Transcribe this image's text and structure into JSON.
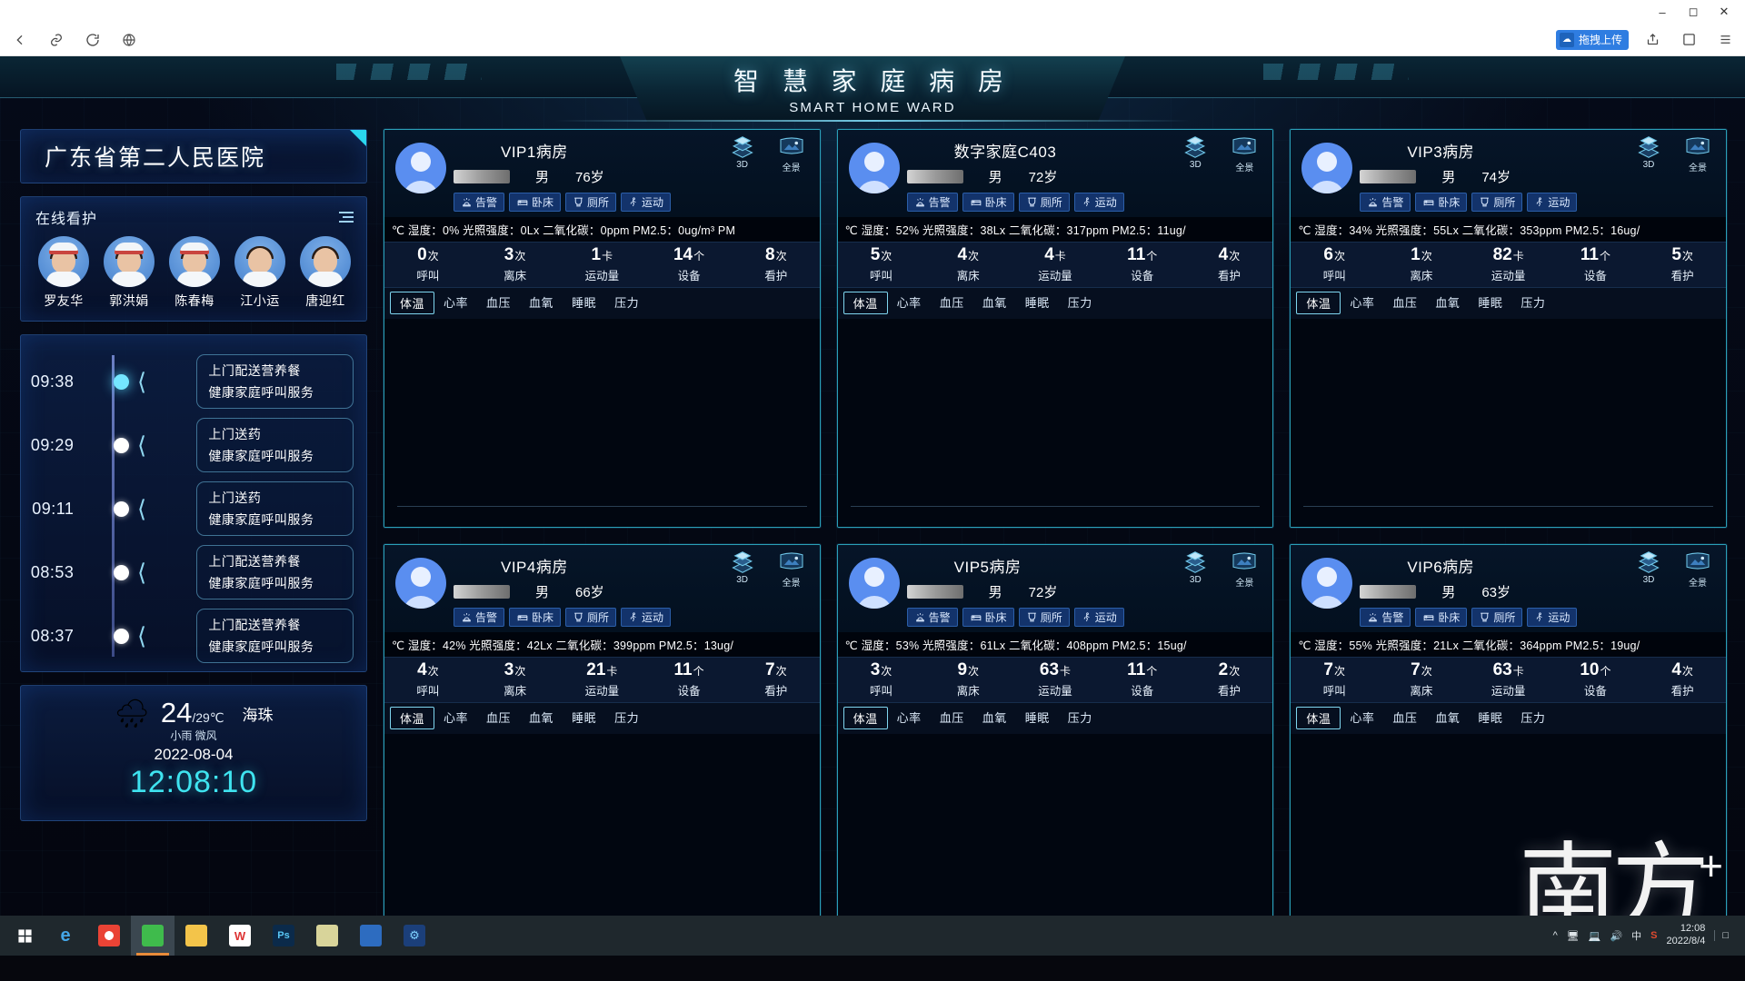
{
  "browser": {
    "window_buttons": [
      "minimize",
      "maximize",
      "close"
    ],
    "toolbar_icons": [
      "back-arrow",
      "link",
      "reload",
      "globe"
    ],
    "upload_chip_label": "拖拽上传",
    "right_icons": [
      "share",
      "box",
      "menu"
    ]
  },
  "header": {
    "title_cn": "智 慧 家 庭 病 房",
    "title_en": "SMART HOME WARD"
  },
  "sidebar": {
    "hospital": "广东省第二人民医院",
    "care": {
      "title": "在线看护",
      "nurses": [
        {
          "name": "罗友华"
        },
        {
          "name": "郭洪娟"
        },
        {
          "name": "陈春梅"
        },
        {
          "name": "江小运"
        },
        {
          "name": "唐迎红"
        }
      ]
    },
    "timeline": [
      {
        "time": "09:38",
        "line1": "上门配送营养餐",
        "line2": "健康家庭呼叫服务",
        "active": true
      },
      {
        "time": "09:29",
        "line1": "上门送药",
        "line2": "健康家庭呼叫服务",
        "active": false
      },
      {
        "time": "09:11",
        "line1": "上门送药",
        "line2": "健康家庭呼叫服务",
        "active": false
      },
      {
        "time": "08:53",
        "line1": "上门配送营养餐",
        "line2": "健康家庭呼叫服务",
        "active": false
      },
      {
        "time": "08:37",
        "line1": "上门配送营养餐",
        "line2": "健康家庭呼叫服务",
        "active": false
      }
    ],
    "weather": {
      "icon": "rain-cloud-icon",
      "temp": "24",
      "temp_high": "/29℃",
      "city": "海珠",
      "desc": "小雨 微风",
      "date": "2022-08-04",
      "clock": "12:08:10"
    }
  },
  "wards": {
    "view_buttons": {
      "threed": "3D",
      "panorama": "全景"
    },
    "tag_labels": {
      "alarm": "告警",
      "bed": "卧床",
      "toilet": "厕所",
      "motion": "运动"
    },
    "vital_tabs": [
      "体温",
      "心率",
      "血压",
      "血氧",
      "睡眠",
      "压力"
    ],
    "stat_keys": [
      "呼叫",
      "离床",
      "运动量",
      "设备",
      "看护"
    ],
    "stat_units": [
      "次",
      "次",
      "卡",
      "个",
      "次"
    ],
    "list": [
      {
        "room": "VIP1病房",
        "sex": "男",
        "age": "76岁",
        "env": "℃ 湿度：0% 光照强度：0Lx 二氧化碳：0ppm PM2.5：0ug/m³ PM",
        "stats": [
          "0",
          "3",
          "1",
          "14",
          "8"
        ],
        "active_tab": "体温"
      },
      {
        "room": "数字家庭C403",
        "sex": "男",
        "age": "72岁",
        "env": "℃ 湿度：52% 光照强度：38Lx 二氧化碳：317ppm PM2.5：11ug/",
        "stats": [
          "5",
          "4",
          "4",
          "11",
          "4"
        ],
        "active_tab": "体温"
      },
      {
        "room": "VIP3病房",
        "sex": "男",
        "age": "74岁",
        "env": "℃ 湿度：34% 光照强度：55Lx 二氧化碳：353ppm PM2.5：16ug/",
        "stats": [
          "6",
          "1",
          "82",
          "11",
          "5"
        ],
        "active_tab": "体温"
      },
      {
        "room": "VIP4病房",
        "sex": "男",
        "age": "66岁",
        "env": "℃ 湿度：42% 光照强度：42Lx 二氧化碳：399ppm PM2.5：13ug/",
        "stats": [
          "4",
          "3",
          "21",
          "11",
          "7"
        ],
        "active_tab": "体温"
      },
      {
        "room": "VIP5病房",
        "sex": "男",
        "age": "72岁",
        "env": "℃ 湿度：53% 光照强度：61Lx 二氧化碳：408ppm PM2.5：15ug/",
        "stats": [
          "3",
          "9",
          "63",
          "11",
          "2"
        ],
        "active_tab": "体温"
      },
      {
        "room": "VIP6病房",
        "sex": "男",
        "age": "63岁",
        "env": "℃ 湿度：55% 光照强度：21Lx 二氧化碳：364ppm PM2.5：19ug/",
        "stats": [
          "7",
          "7",
          "63",
          "10",
          "4"
        ],
        "active_tab": "体温"
      }
    ]
  },
  "watermark": {
    "zh": "南方",
    "plus": "+"
  },
  "taskbar": {
    "apps": [
      "start-icon",
      "edge-icon",
      "chrome-icon",
      "wechat-icon",
      "explorer-icon",
      "wps-icon",
      "photoshop-icon",
      "note-icon",
      "blue-app-icon",
      "settings-icon"
    ],
    "tray_icons": [
      "chevron-up",
      "screen",
      "network",
      "volume",
      "ime-cn",
      "security"
    ],
    "clock_time": "12:08",
    "clock_date": "2022/8/4"
  },
  "colors": {
    "accent_cyan": "#2ad7ef",
    "panel_border": "#2aa0b8",
    "clock": "#3fe4f0",
    "tag_bg": "#13336b"
  }
}
